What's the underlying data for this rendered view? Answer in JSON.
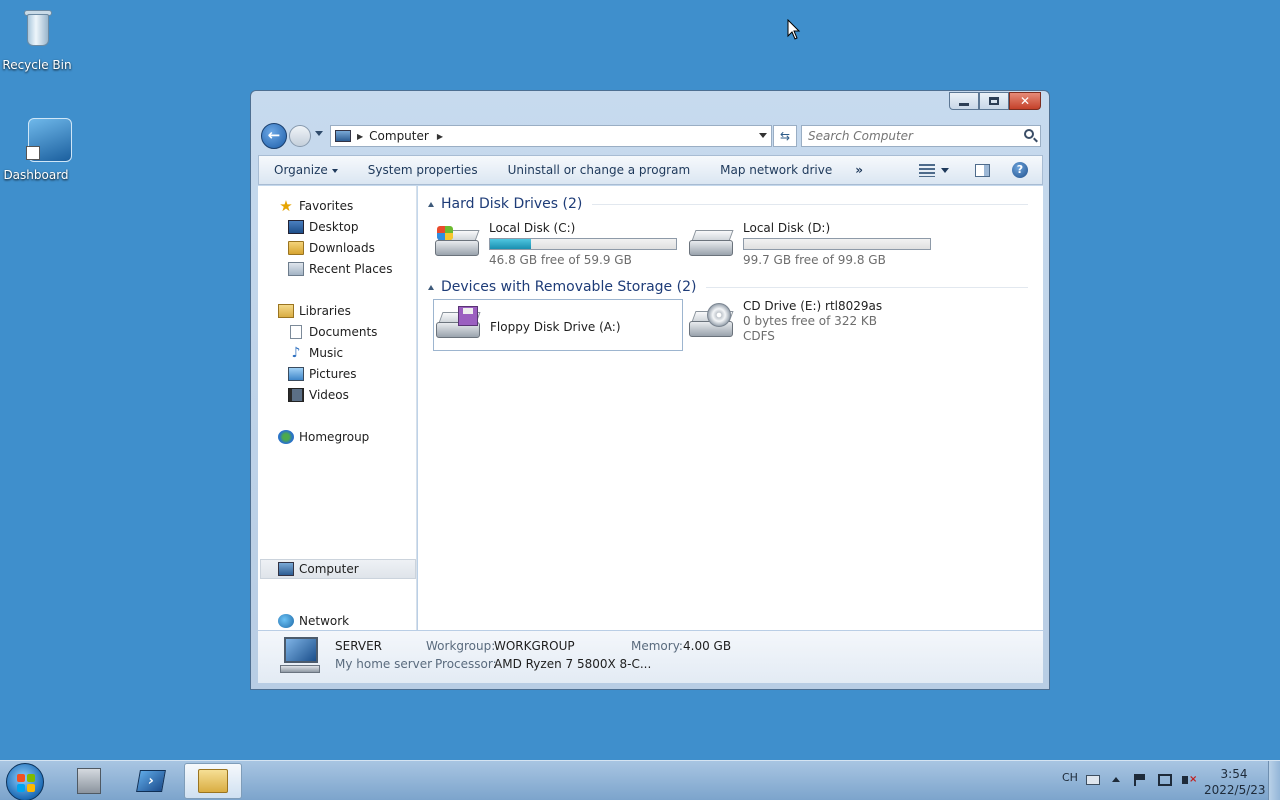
{
  "desktop": {
    "icons": [
      {
        "label": "Recycle Bin",
        "icon": "recycle-bin-icon"
      },
      {
        "label": "Dashboard",
        "icon": "dashboard-icon"
      }
    ]
  },
  "window": {
    "address": {
      "crumb": "Computer"
    },
    "search": {
      "placeholder": "Search Computer"
    },
    "commands": {
      "organize": "Organize",
      "system_properties": "System properties",
      "uninstall": "Uninstall or change a program",
      "map_drive": "Map network drive",
      "more": "»"
    },
    "help_glyph": "?",
    "nav": {
      "favorites": "Favorites",
      "desktop": "Desktop",
      "downloads": "Downloads",
      "recent_places": "Recent Places",
      "libraries": "Libraries",
      "documents": "Documents",
      "music": "Music",
      "pictures": "Pictures",
      "videos": "Videos",
      "homegroup": "Homegroup",
      "computer": "Computer",
      "network": "Network"
    },
    "groups": {
      "hdd_title": "Hard Disk Drives (2)",
      "removable_title": "Devices with Removable Storage (2)"
    },
    "drives": {
      "c": {
        "name": "Local Disk (C:)",
        "free_text": "46.8 GB free of 59.9 GB",
        "used_fraction": 0.219
      },
      "d": {
        "name": "Local Disk (D:)",
        "free_text": "99.7 GB free of 99.8 GB",
        "used_fraction": 0.001
      },
      "a": {
        "name": "Floppy Disk Drive (A:)"
      },
      "e": {
        "name": "CD Drive (E:) rtl8029as",
        "free_text": "0 bytes free of 322 KB",
        "fs": "CDFS"
      }
    },
    "details": {
      "name": "SERVER",
      "description": "My home server",
      "workgroup_label": "Workgroup:",
      "workgroup": "WORKGROUP",
      "memory_label": "Memory:",
      "memory": "4.00 GB",
      "processor_label": "Processor:",
      "processor": "AMD Ryzen 7 5800X 8-C..."
    }
  },
  "taskbar": {
    "lang": "CH",
    "time": "3:54",
    "date": "2022/5/23"
  },
  "colors": {
    "desktop": "#3f8fcc",
    "accent": "#1e3c78",
    "bar_fill": "#1a8fb0"
  }
}
